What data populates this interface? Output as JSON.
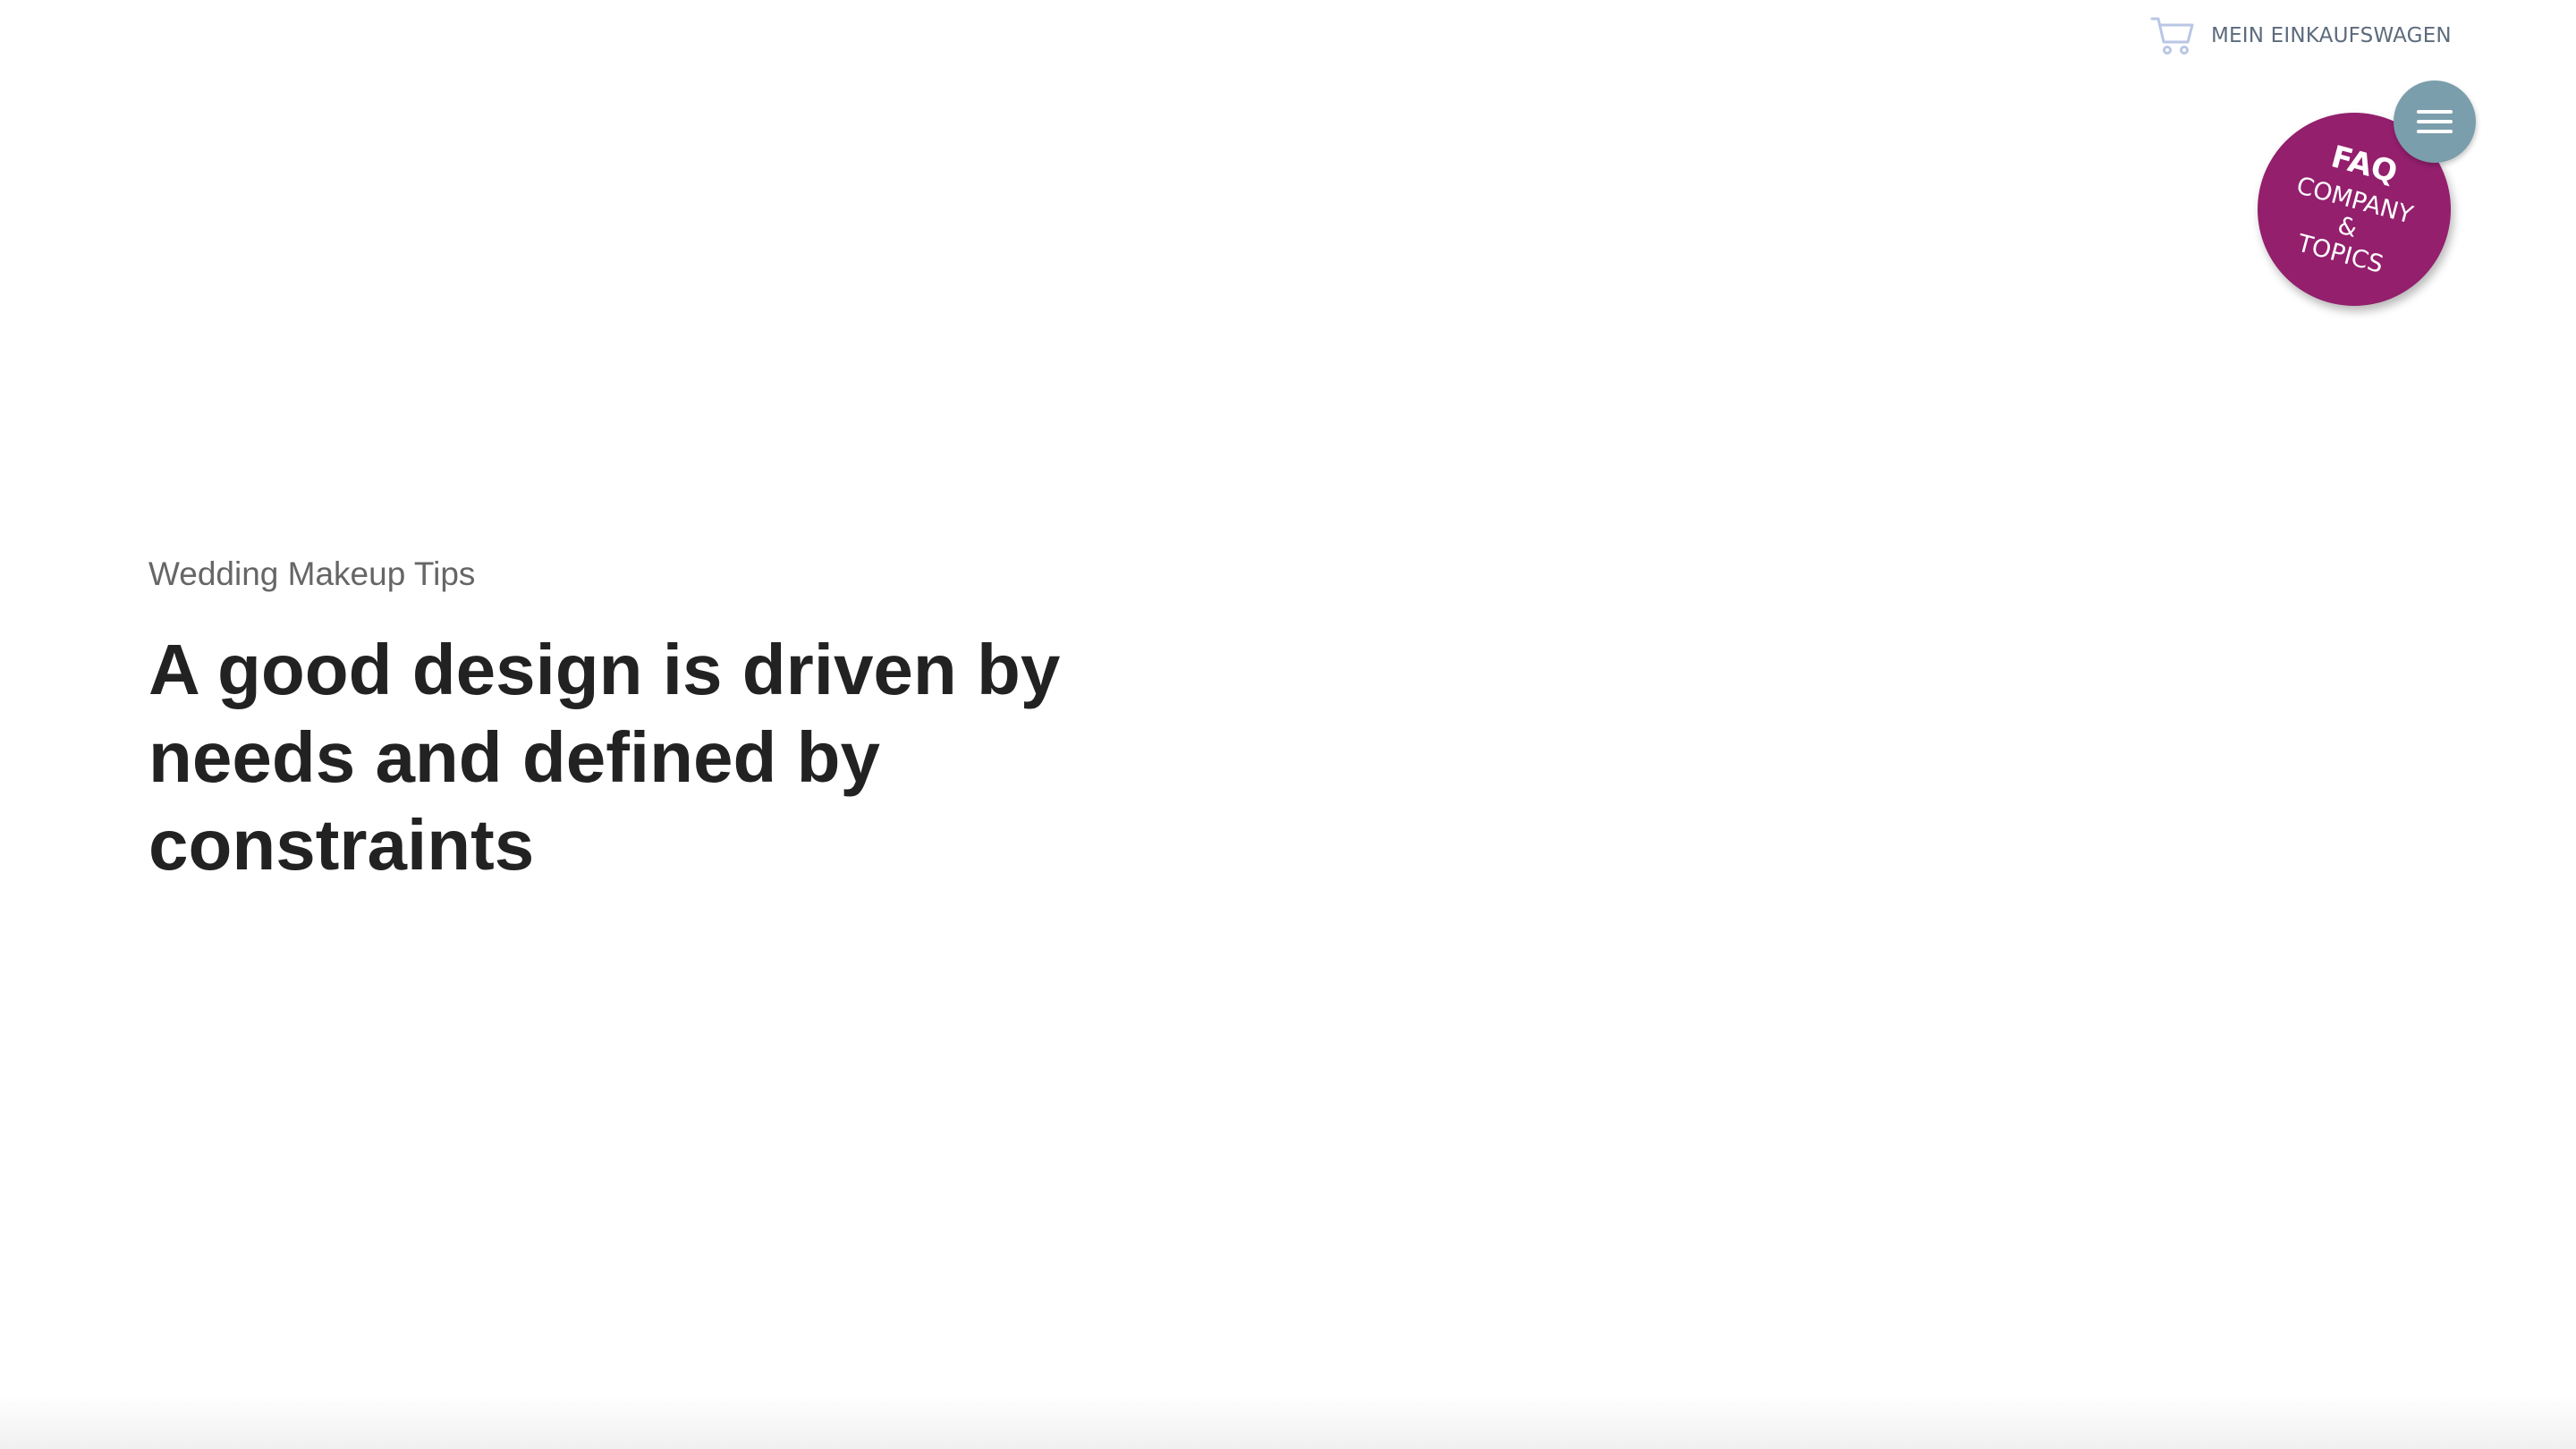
{
  "header": {
    "cart_label": "MEIN EINKAUFSWAGEN",
    "cart_icon": "shopping-cart-icon",
    "menu_icon": "hamburger-menu-icon"
  },
  "faq_badge": {
    "title": "FAQ",
    "line1": "COMPANY",
    "line2": "&",
    "line3": "TOPICS",
    "color": "#931f6d"
  },
  "hero": {
    "eyebrow": "Wedding Makeup Tips",
    "headline": "A good design is driven by needs and defined by constraints"
  },
  "colors": {
    "menu_button": "#7a9eab",
    "cart_text": "#5c6b7d",
    "headline": "#222222",
    "eyebrow": "#666666"
  }
}
